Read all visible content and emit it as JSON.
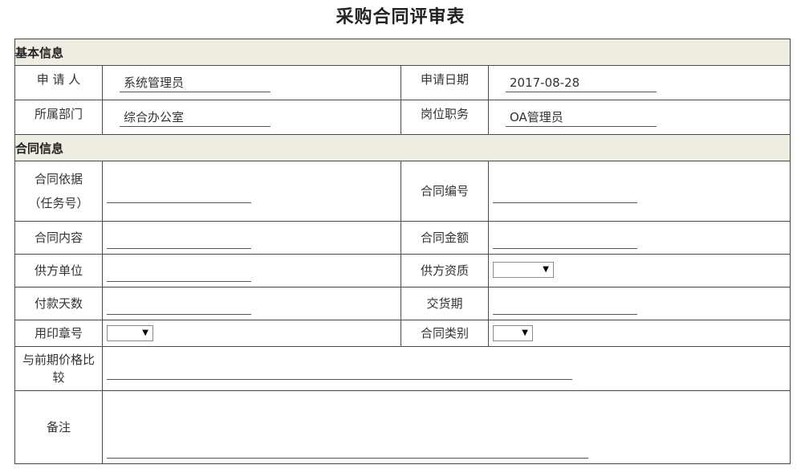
{
  "form_title": "采购合同评审表",
  "sections": {
    "basic": "基本信息",
    "contract": "合同信息"
  },
  "basic": {
    "applicant_label": "申 请 人",
    "applicant_value": "系统管理员",
    "apply_date_label": "申请日期",
    "apply_date_value": "2017-08-28",
    "department_label": "所属部门",
    "department_value": "综合办公室",
    "position_label": "岗位职务",
    "position_value": "OA管理员"
  },
  "contract": {
    "basis_label_line1": "合同依据",
    "basis_label_line2": "（任务号）",
    "basis_value": "",
    "number_label": "合同编号",
    "number_value": "",
    "content_label": "合同内容",
    "content_value": "",
    "amount_label": "合同金额",
    "amount_value": "",
    "supplier_label": "供方单位",
    "supplier_value": "",
    "qualification_label": "供方资质",
    "qualification_value": "",
    "payment_days_label": "付款天数",
    "payment_days_value": "",
    "delivery_label": "交货期",
    "delivery_value": "",
    "seal_label": "用印章号",
    "seal_value": "",
    "type_label": "合同类别",
    "type_value": "",
    "price_compare_label_line1": "与前期价格比",
    "price_compare_label_line2": "较",
    "price_compare_value": "",
    "remarks_label": "备注",
    "remarks_value": ""
  },
  "icons": {
    "dropdown_arrow": "▼"
  }
}
